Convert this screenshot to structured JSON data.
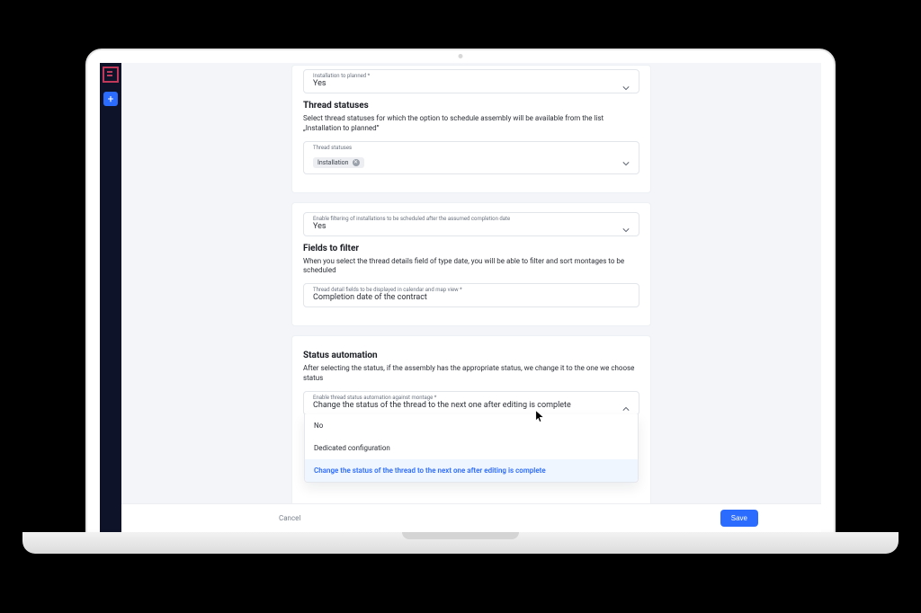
{
  "sidebar": {
    "plus_label": "+"
  },
  "section_installation": {
    "field_label": "Installation to planned *",
    "field_value": "Yes"
  },
  "section_thread_statuses": {
    "title": "Thread statuses",
    "description": "Select thread statuses for which the option to schedule assembly will be available from the list „Installation to planned”",
    "field_label": "Thread statuses",
    "chip_label": "Installation"
  },
  "section_filtering": {
    "field_label": "Enable filtering of installations to be scheduled after the assumed completion date",
    "field_value": "Yes"
  },
  "section_fields_filter": {
    "title": "Fields to filter",
    "description": "When you select the thread details field of type date, you will be able to filter and sort montages to be scheduled",
    "field_label": "Thread detail fields to be displayed in calendar and map view *",
    "field_value": "Completion date of the contract"
  },
  "section_status_automation": {
    "title": "Status automation",
    "description": "After selecting the status, if the assembly has the appropriate status, we change it to the one we choose status",
    "field_label": "Enable thread status automation against montage *",
    "field_value": "Change the status of the thread to the next one after editing is complete",
    "options": [
      "No",
      "Dedicated configuration",
      "Change the status of the thread to the next one after editing is complete"
    ]
  },
  "footer": {
    "cancel": "Cancel",
    "save": "Save"
  }
}
